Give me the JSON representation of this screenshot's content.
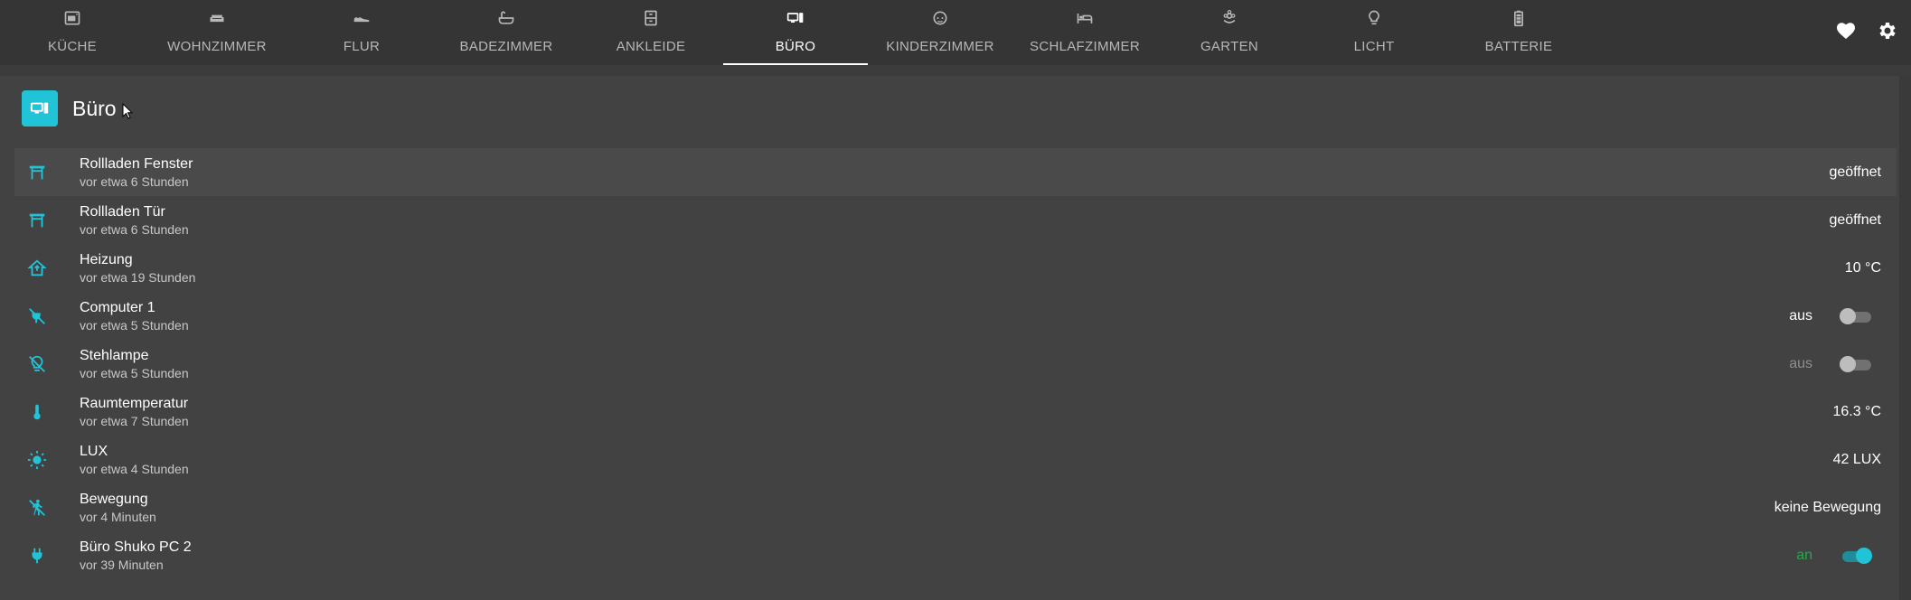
{
  "tabs": [
    {
      "label": "KÜCHE",
      "icon": "stove-icon"
    },
    {
      "label": "WOHNZIMMER",
      "icon": "sofa-icon"
    },
    {
      "label": "FLUR",
      "icon": "shoe-icon"
    },
    {
      "label": "BADEZIMMER",
      "icon": "bathtub-icon"
    },
    {
      "label": "ANKLEIDE",
      "icon": "wardrobe-icon"
    },
    {
      "label": "BÜRO",
      "icon": "desktop-icon"
    },
    {
      "label": "KINDERZIMMER",
      "icon": "baby-face-icon"
    },
    {
      "label": "SCHLAFZIMMER",
      "icon": "bed-icon"
    },
    {
      "label": "GARTEN",
      "icon": "flower-icon"
    },
    {
      "label": "LICHT",
      "icon": "lightbulb-icon"
    },
    {
      "label": "BATTERIE",
      "icon": "battery-icon"
    }
  ],
  "active_tab": "BÜRO",
  "header_actions": [
    "heart-icon",
    "gear-icon"
  ],
  "card": {
    "title": "Büro",
    "icon": "desktop-icon",
    "accent_color": "#21c3d6"
  },
  "rows": [
    {
      "name": "Rollladen Fenster",
      "time": "vor etwa 6 Stunden",
      "state": "geöffnet",
      "icon": "window-shutter-icon"
    },
    {
      "name": "Rollladen Tür",
      "time": "vor etwa 6 Stunden",
      "state": "geöffnet",
      "icon": "window-shutter-icon"
    },
    {
      "name": "Heizung",
      "time": "vor etwa 19 Stunden",
      "state": "10 °C",
      "icon": "home-thermostat-icon"
    },
    {
      "name": "Computer 1",
      "time": "vor etwa 5 Stunden",
      "state": "aus",
      "icon": "power-plug-off-icon",
      "toggle": false
    },
    {
      "name": "Stehlampe",
      "time": "vor etwa 5 Stunden",
      "state": "aus",
      "icon": "lightbulb-off-icon",
      "toggle": false
    },
    {
      "name": "Raumtemperatur",
      "time": "vor etwa 7 Stunden",
      "state": "16.3 °C",
      "icon": "thermometer-icon"
    },
    {
      "name": "LUX",
      "time": "vor etwa 4 Stunden",
      "state": "42 LUX",
      "icon": "brightness-icon"
    },
    {
      "name": "Bewegung",
      "time": "vor 4 Minuten",
      "state": "keine Bewegung",
      "icon": "walk-off-icon"
    },
    {
      "name": "Büro Shuko PC 2",
      "time": "vor 39 Minuten",
      "state": "an",
      "icon": "power-plug-icon",
      "toggle": true
    }
  ]
}
